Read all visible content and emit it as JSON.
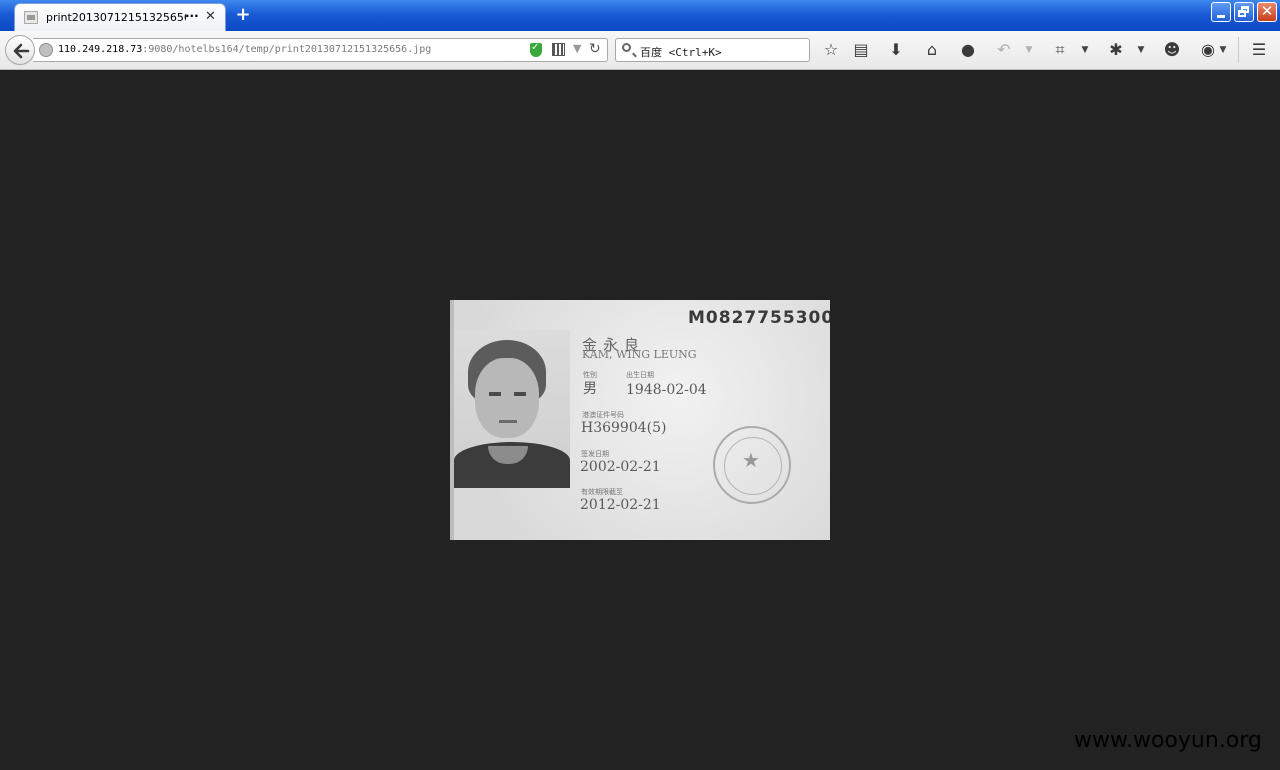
{
  "browser": {
    "tab_title": "print20130712151325656.",
    "tab_more": "···",
    "url_host": "110.249.218.73",
    "url_path": ":9080/hotelbs164/temp/print20130712151325656.jpg",
    "search_placeholder": "百度 <Ctrl+K>"
  },
  "document": {
    "card_number": "M0827755300",
    "name_cn": "金永良",
    "name_en": "KAM, WING LEUNG",
    "sex_label": "性别",
    "sex_value": "男",
    "dob_label": "出生日期",
    "dob_value": "1948-02-04",
    "permit_label": "港澳证件号码",
    "permit_value": "H369904(5)",
    "issue_label": "签发日期",
    "issue_value": "2002-02-21",
    "expiry_label": "有效期限截至",
    "expiry_value": "2012-02-21"
  },
  "watermark": "www.wooyun.org"
}
